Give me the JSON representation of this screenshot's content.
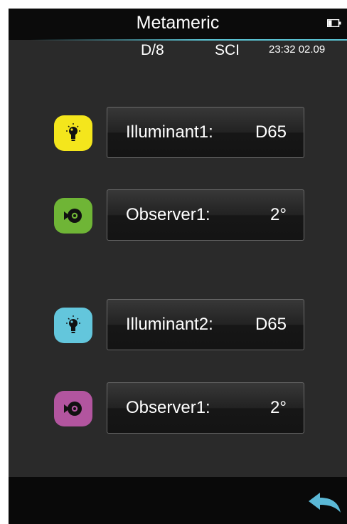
{
  "header": {
    "title": "Metameric",
    "battery_icon": "battery-icon"
  },
  "status": {
    "geometry": "D/8",
    "mode": "SCI",
    "datetime": "23:32  02.09"
  },
  "settings": [
    {
      "label": "Illuminant1:",
      "value": "D65",
      "icon": "lightbulb-icon",
      "icon_color": "#f4e61c"
    },
    {
      "label": "Observer1:",
      "value": "2°",
      "icon": "observer-eye-icon",
      "icon_color": "#6fb536"
    },
    {
      "label": "Illuminant2:",
      "value": "D65",
      "icon": "lightbulb-icon",
      "icon_color": "#63c6dc"
    },
    {
      "label": "Observer1:",
      "value": "2°",
      "icon": "observer-eye-icon",
      "icon_color": "#b2559f"
    }
  ],
  "footer": {
    "back_icon": "back-arrow-icon",
    "accent_color": "#5bb8d6"
  }
}
